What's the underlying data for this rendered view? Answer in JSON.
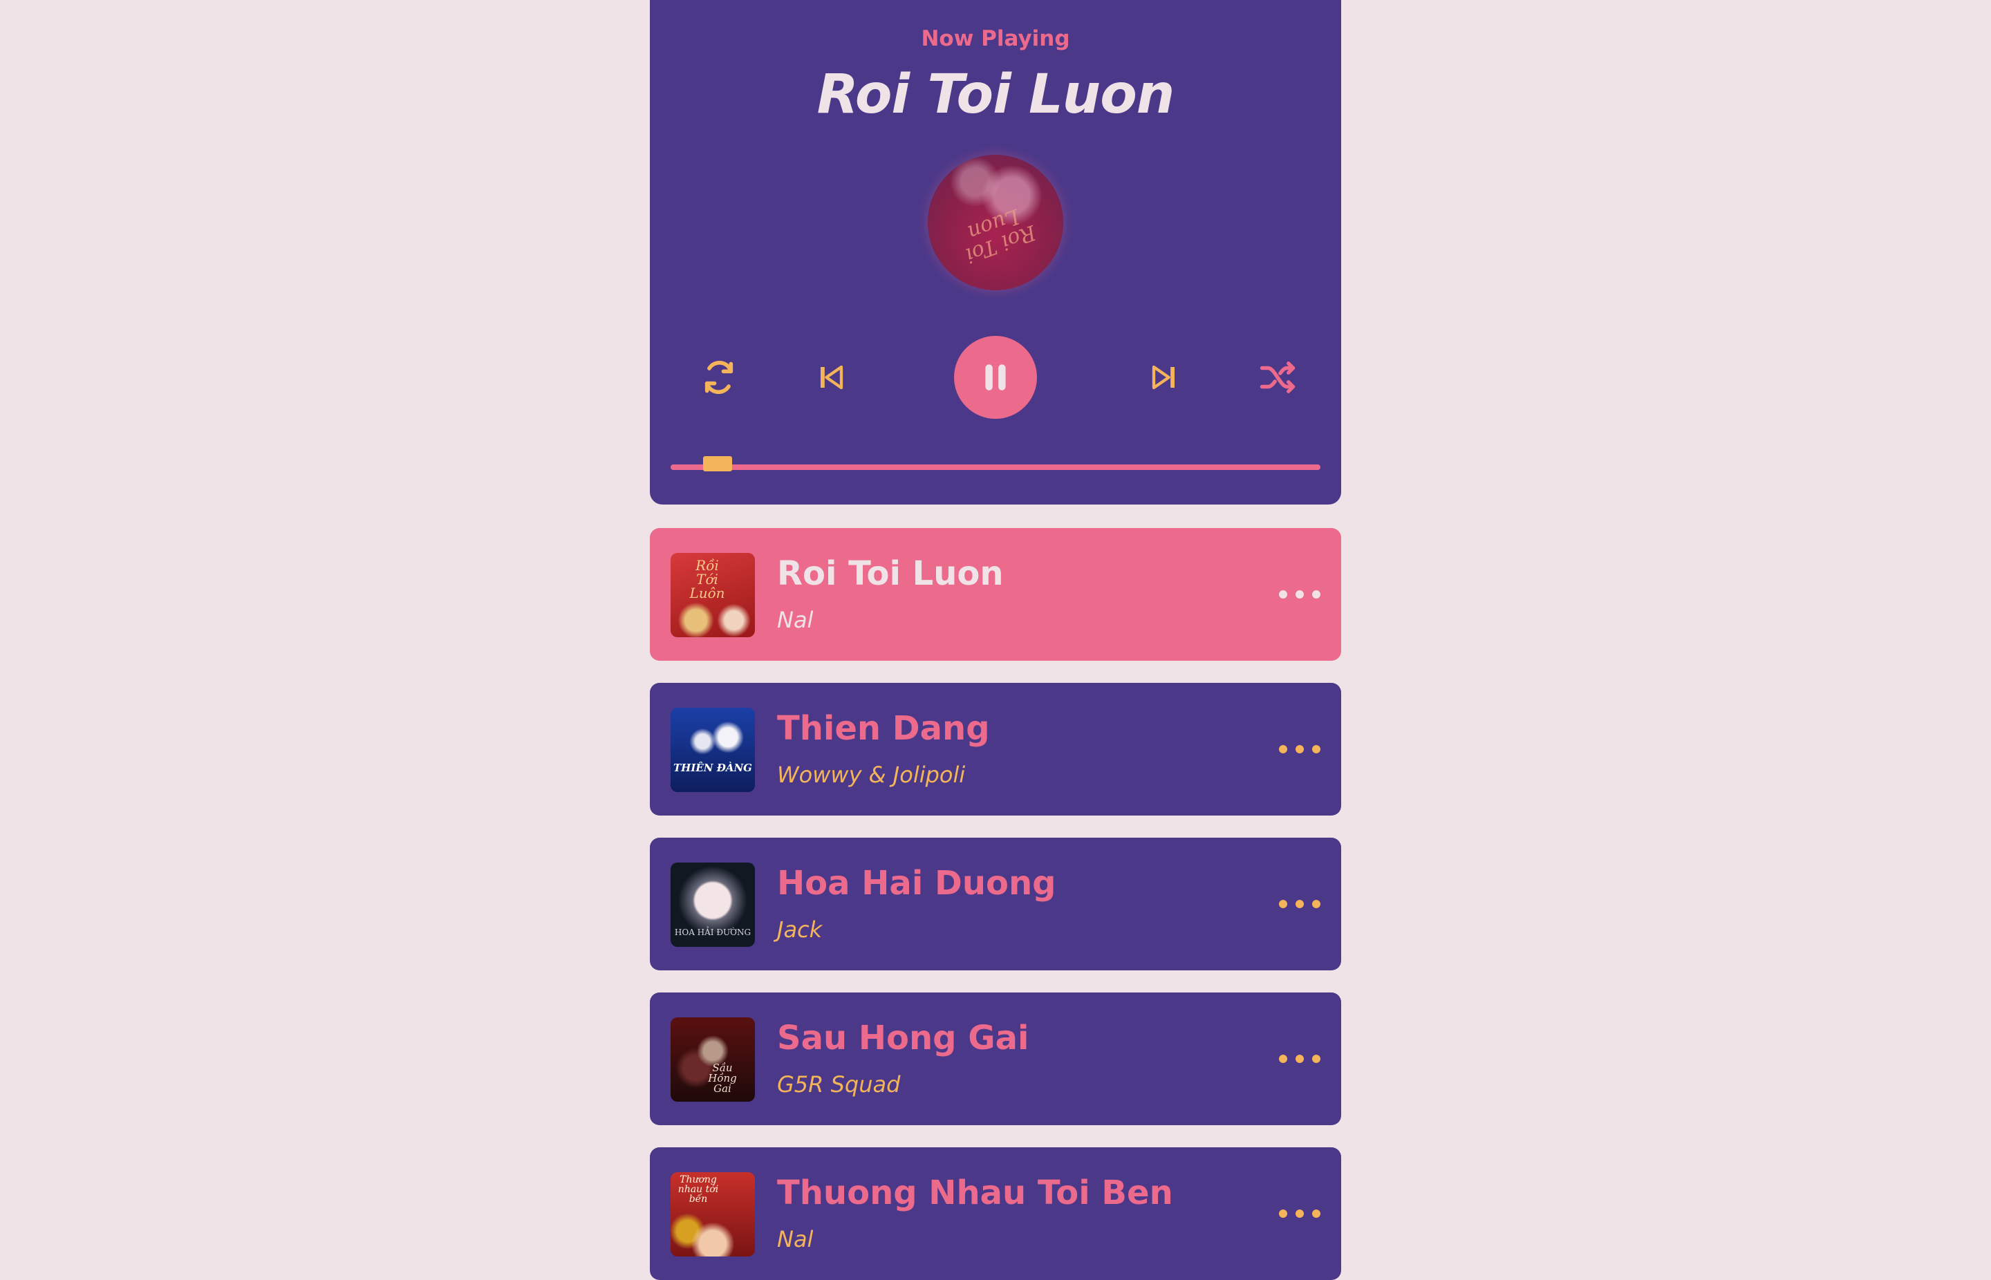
{
  "header": {
    "now_playing_label": "Now Playing",
    "current_title": "Roi Toi Luon",
    "disc_text": "Roi Toi Luon"
  },
  "controls": {
    "repeat_icon": "repeat-icon",
    "prev_icon": "skip-previous-icon",
    "play_pause_icon": "pause-icon",
    "next_icon": "skip-next-icon",
    "shuffle_icon": "shuffle-icon"
  },
  "progress": {
    "fraction": 0.05
  },
  "colors": {
    "background": "#efe3e8",
    "panel": "#4b3889",
    "accent_pink": "#ec6a8c",
    "accent_orange": "#f4b45a"
  },
  "playlist": [
    {
      "title": "Roi Toi Luon",
      "artist": "Nal",
      "active": true,
      "thumb_text": "Rồi Tới Luôn"
    },
    {
      "title": "Thien Dang",
      "artist": "Wowwy & Jolipoli",
      "active": false,
      "thumb_text": "THIÊN ĐÀNG"
    },
    {
      "title": "Hoa Hai Duong",
      "artist": "Jack",
      "active": false,
      "thumb_text": "HOA HẢI ĐƯỜNG"
    },
    {
      "title": "Sau Hong Gai",
      "artist": "G5R Squad",
      "active": false,
      "thumb_text": "Sầu Hồng Gai"
    },
    {
      "title": "Thuong Nhau Toi Ben",
      "artist": "Nal",
      "active": false,
      "thumb_text": "Thương nhau tới bến"
    }
  ]
}
